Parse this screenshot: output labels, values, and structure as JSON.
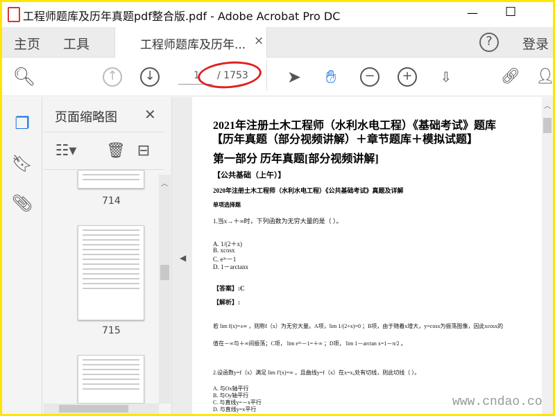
{
  "window": {
    "title": "工程师题库及历年真题pdf整合版.pdf - Adobe Acrobat Pro DC",
    "minimize": "—",
    "maximize": "☐"
  },
  "tabs": {
    "home": "主页",
    "tools": "工具",
    "document_tab": "工程师题库及历年...",
    "close": "×",
    "help": "?",
    "login": "登录"
  },
  "toolbar": {
    "current_page": "1",
    "total_pages": "/ 1753"
  },
  "sidebar": {
    "title": "页面缩略图",
    "close": "✕",
    "thumbnails": [
      {
        "label": "714"
      },
      {
        "label": "715"
      }
    ]
  },
  "document": {
    "title1": "2021年注册土木工程师（水利水电工程）《基础考试》题库",
    "title2": "【历年真题（部分视频讲解）＋章节题库＋模拟试题】",
    "part": "第一部分 历年真题[部分视频讲解]",
    "section": "【公共基础（上午）】",
    "exam": "2020年注册土木工程师（水利水电工程）《公共基础考试》真题及详解",
    "qtype": "单项选择题",
    "q1": "1.当x→＋∞时，下列函数为无穷大量的是（ ）。",
    "q1_options": [
      "A. 1/(2＋x)",
      "B. xcosx",
      "C. e³ˣ－1",
      "D. 1－arctanx"
    ],
    "answer": "【答案】:C",
    "analysis": "【解析】:",
    "exp1": "若 lim f(x)=±∞ ，则称f（x）为无穷大量。A项，lim 1/(2+x)=0 ；B项，由于随着x增大，y=cosx为振荡图像，因此xcosx的",
    "exp2": "值在－∞与＋∞间振荡；C项， lim e³ˣ－1=＋∞ ；D项， lim 1－arctan x=1－π/2 。",
    "q2": "2.设函数y=f（x）满足 lim f′(x)=∞ ，且曲线y=f（x）在x=x₀处有切线，则此切线（ ）。",
    "q2_options": [
      "A. 与Ox轴平行",
      "B. 与Oy轴平行",
      "C. 与直线y=－x平行",
      "D. 与直线y=x平行"
    ]
  },
  "watermark": "www.cndao.com",
  "colors": {
    "accent": "#1473e6",
    "frame": "#ffe600",
    "annotation": "#e02020"
  }
}
